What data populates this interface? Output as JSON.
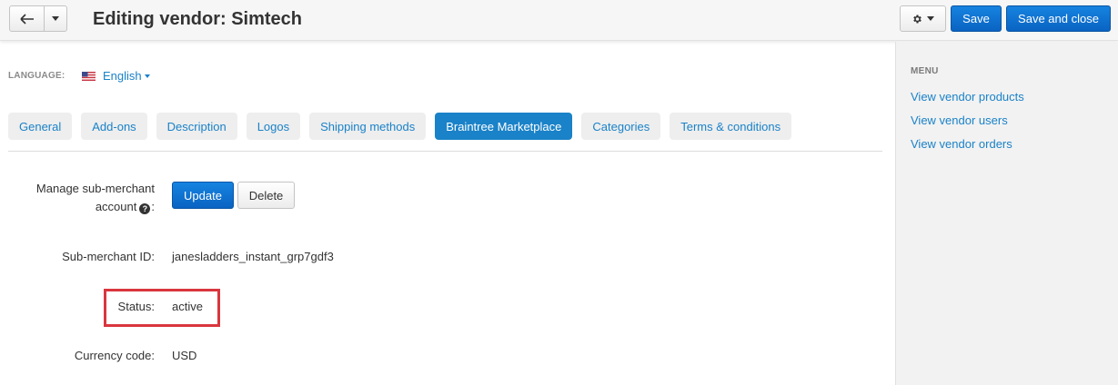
{
  "header": {
    "title": "Editing vendor: Simtech",
    "save_label": "Save",
    "save_close_label": "Save and close"
  },
  "language": {
    "label": "LANGUAGE:",
    "value": "English"
  },
  "tabs": [
    {
      "label": "General",
      "active": false
    },
    {
      "label": "Add-ons",
      "active": false
    },
    {
      "label": "Description",
      "active": false
    },
    {
      "label": "Logos",
      "active": false
    },
    {
      "label": "Shipping methods",
      "active": false
    },
    {
      "label": "Braintree Marketplace",
      "active": true
    },
    {
      "label": "Categories",
      "active": false
    },
    {
      "label": "Terms & conditions",
      "active": false
    }
  ],
  "fields": {
    "manage_label_line1": "Manage sub-merchant",
    "manage_label_line2": "account",
    "update_label": "Update",
    "delete_label": "Delete",
    "submerchant_id_label": "Sub-merchant ID:",
    "submerchant_id_value": "janesladders_instant_grp7gdf3",
    "status_label": "Status:",
    "status_value": "active",
    "currency_label": "Currency code:",
    "currency_value": "USD"
  },
  "sidebar": {
    "title": "MENU",
    "links": [
      {
        "label": "View vendor products"
      },
      {
        "label": "View vendor users"
      },
      {
        "label": "View vendor orders"
      }
    ]
  },
  "colors": {
    "accent": "#1a82c8",
    "primary_button": "#0a63c2",
    "highlight": "#d9363e"
  },
  "icons": {
    "back": "back-arrow-icon",
    "dropdown": "chevron-down-icon",
    "settings": "gear-icon",
    "flag": "us-flag-icon",
    "help": "question-circle-icon"
  }
}
